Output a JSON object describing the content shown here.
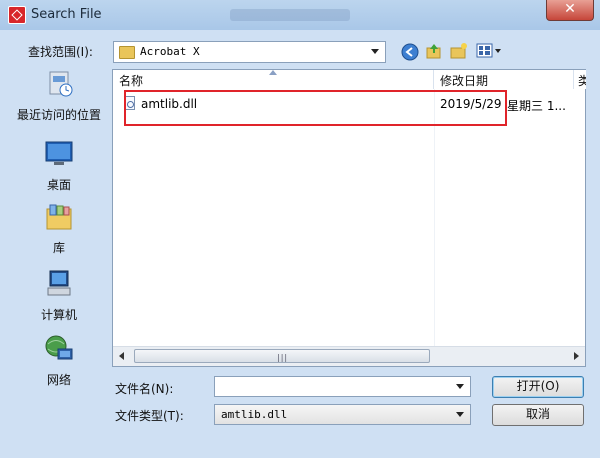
{
  "window": {
    "title": "Search File",
    "close_label": "✕"
  },
  "toolbar": {
    "look_in_label": "查找范围(I):",
    "look_in_value": "Acrobat X"
  },
  "places": [
    {
      "label": "最近访问的位置",
      "icon": "recent-places-icon"
    },
    {
      "label": "桌面",
      "icon": "desktop-icon"
    },
    {
      "label": "库",
      "icon": "libraries-icon"
    },
    {
      "label": "计算机",
      "icon": "computer-icon"
    },
    {
      "label": "网络",
      "icon": "network-icon"
    }
  ],
  "list": {
    "columns": [
      "名称",
      "修改日期",
      "类"
    ],
    "rows": [
      {
        "name": "amtlib.dll",
        "date": "2019/5/29",
        "extra": "星期三 1..."
      }
    ]
  },
  "scrollbar": {
    "grip": "|||"
  },
  "footer": {
    "filename_label": "文件名(N):",
    "filename_value": "",
    "filetype_label": "文件类型(T):",
    "filetype_value": "amtlib.dll",
    "open_label": "打开(O)",
    "cancel_label": "取消"
  },
  "colors": {
    "highlight_box": "#e0242a",
    "window_bg": "#cfe0f3"
  }
}
